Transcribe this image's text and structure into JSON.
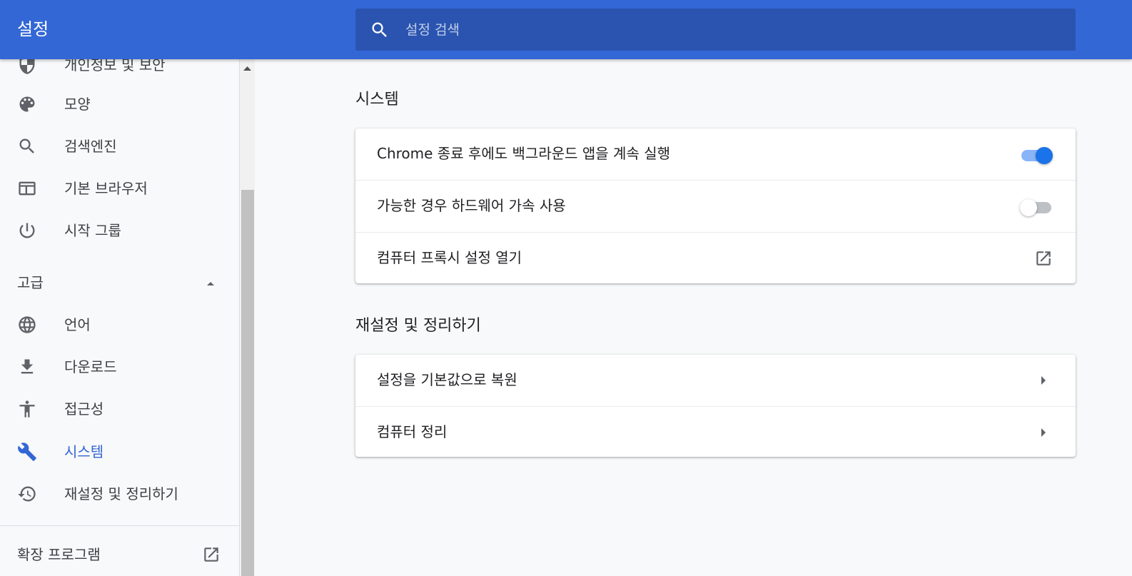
{
  "header": {
    "title": "설정",
    "search_placeholder": "설정 검색"
  },
  "sidebar": {
    "items": [
      {
        "label": "개인정보 및 보안",
        "icon": "shield-icon"
      },
      {
        "label": "모양",
        "icon": "palette-icon"
      },
      {
        "label": "검색엔진",
        "icon": "search-icon"
      },
      {
        "label": "기본 브라우저",
        "icon": "browser-window-icon"
      },
      {
        "label": "시작 그룹",
        "icon": "power-icon"
      }
    ],
    "advanced_label": "고급",
    "advanced_items": [
      {
        "label": "언어",
        "icon": "globe-icon"
      },
      {
        "label": "다운로드",
        "icon": "download-icon"
      },
      {
        "label": "접근성",
        "icon": "accessibility-icon"
      },
      {
        "label": "시스템",
        "icon": "wrench-icon",
        "active": true
      },
      {
        "label": "재설정 및 정리하기",
        "icon": "history-icon"
      }
    ],
    "extensions_label": "확장 프로그램"
  },
  "main": {
    "system": {
      "title": "시스템",
      "rows": [
        {
          "label": "Chrome 종료 후에도 백그라운드 앱을 계속 실행",
          "control": "toggle",
          "checked": true
        },
        {
          "label": "가능한 경우 하드웨어 가속 사용",
          "control": "toggle",
          "checked": false
        },
        {
          "label": "컴퓨터 프록시 설정 열기",
          "control": "external-link-icon"
        }
      ]
    },
    "reset": {
      "title": "재설정 및 정리하기",
      "rows": [
        {
          "label": "설정을 기본값으로 복원",
          "control": "arrow-right-icon"
        },
        {
          "label": "컴퓨터 정리",
          "control": "arrow-right-icon"
        }
      ]
    }
  },
  "colors": {
    "header_bg": "#3367d6",
    "search_bg": "#2a54b0",
    "accent": "#1a73e8",
    "active_nav": "#3367d6"
  }
}
